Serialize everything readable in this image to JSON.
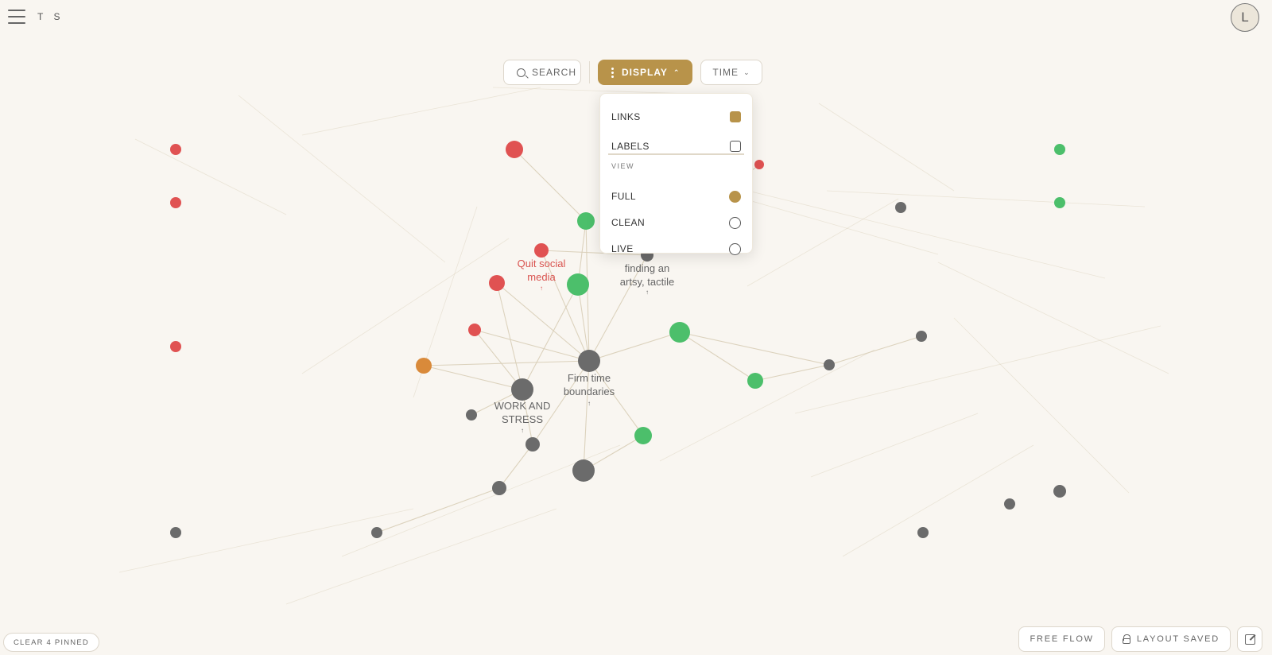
{
  "app": {
    "title": "T S",
    "avatar_initial": "L"
  },
  "toolbar": {
    "search_label": "SEARCH",
    "display_label": "DISPLAY",
    "time_label": "TIME"
  },
  "display_menu": {
    "toggles": [
      {
        "label": "LINKS",
        "checked": true
      },
      {
        "label": "LABELS",
        "checked": false
      }
    ],
    "view_section_label": "VIEW",
    "view_options": [
      {
        "label": "FULL",
        "selected": true
      },
      {
        "label": "CLEAN",
        "selected": false
      },
      {
        "label": "LIVE",
        "selected": false
      }
    ]
  },
  "graph_labels": [
    {
      "text": "Quit social media",
      "color": "#d9534f"
    },
    {
      "text": "finding an artsy, tactile",
      "color": "#666666"
    },
    {
      "text": "Firm time boundaries",
      "color": "#666666"
    },
    {
      "text": "WORK AND STRESS",
      "color": "#666666"
    }
  ],
  "footer": {
    "clear_pinned_label": "CLEAR 4 PINNED",
    "free_flow_label": "FREE FLOW",
    "layout_saved_label": "LAYOUT SAVED"
  },
  "colors": {
    "accent": "#b8934a",
    "background": "#f9f6f1",
    "node_red": "#e05252",
    "node_green": "#4cbf6b",
    "node_gray": "#6b6b6b",
    "node_orange": "#d98a3a",
    "link": "#d9cfb8"
  }
}
